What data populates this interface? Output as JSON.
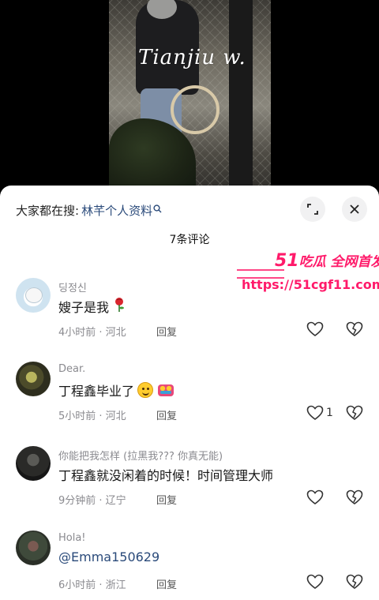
{
  "video": {
    "watermark": "Tianjiu w."
  },
  "header": {
    "search_prefix": "大家都在搜:",
    "search_term": "林芊个人资料",
    "comment_count": "7条评论"
  },
  "ad": {
    "brand_num": "51",
    "brand": "吃瓜 全网首发",
    "url": "https://51cgf11.com"
  },
  "comments": [
    {
      "name": "딩정신",
      "text": "嫂子是我",
      "meta": "4小时前 · 河北",
      "reply": "回复",
      "likes": ""
    },
    {
      "name": "Dear.",
      "text": "丁程鑫毕业了",
      "meta": "5小时前 · 河北",
      "reply": "回复",
      "likes": "1"
    },
    {
      "name": "你能把我怎样 (拉黑我??? 你真无能)",
      "text": "丁程鑫就没闲着的时候！时间管理大师",
      "meta": "9分钟前 · 辽宁",
      "reply": "回复",
      "likes": ""
    },
    {
      "name": "Hola!",
      "text": "@Emma150629",
      "meta": "6小时前 · 浙江",
      "reply": "回复",
      "likes": ""
    }
  ]
}
